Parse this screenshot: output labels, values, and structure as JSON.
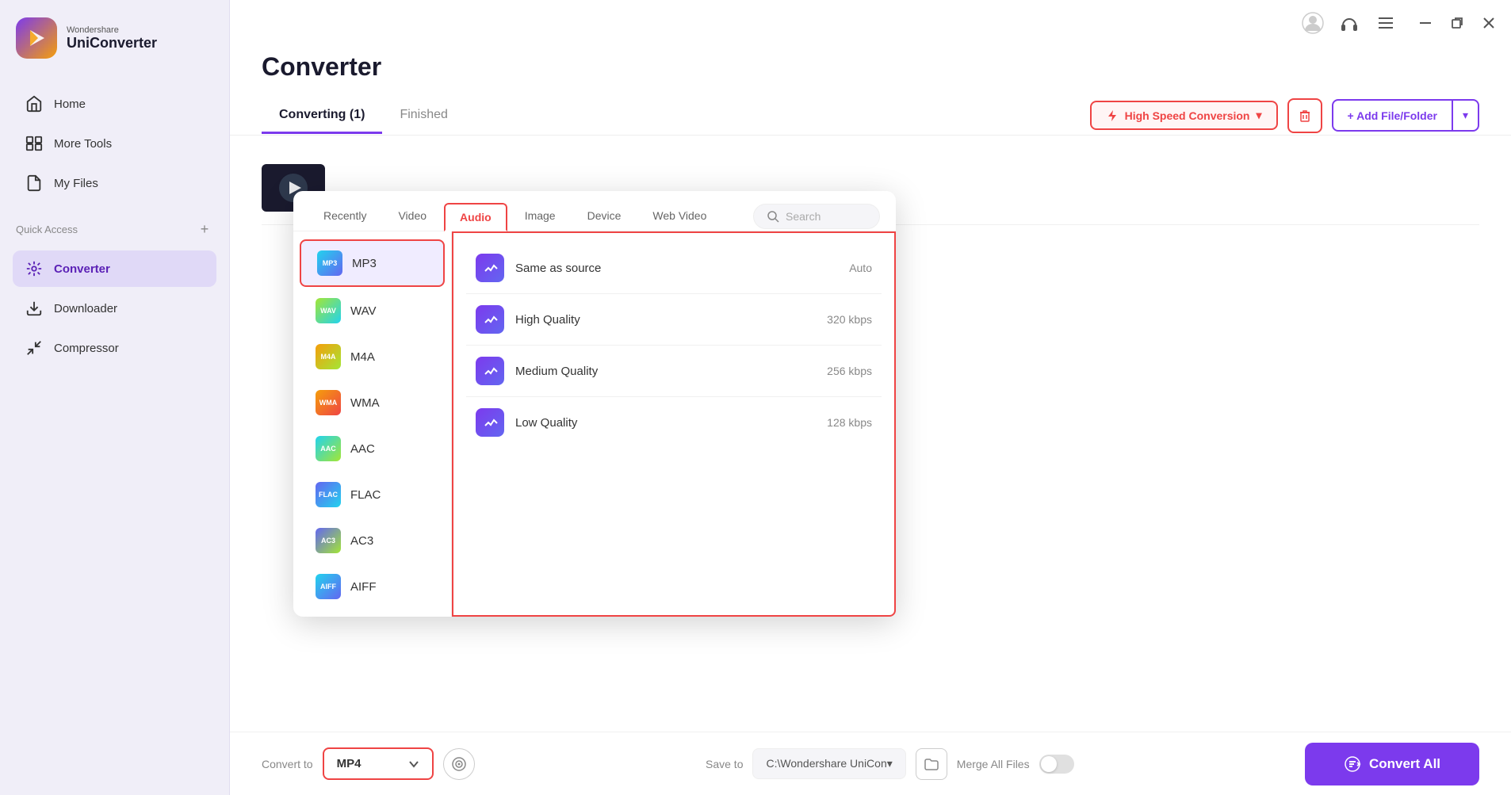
{
  "sidebar": {
    "brand": "Wondershare",
    "app_name": "UniConverter",
    "nav_items": [
      {
        "id": "home",
        "label": "Home",
        "active": false
      },
      {
        "id": "more-tools",
        "label": "More Tools",
        "active": false
      },
      {
        "id": "my-files",
        "label": "My Files",
        "active": false
      },
      {
        "id": "converter",
        "label": "Converter",
        "active": true
      },
      {
        "id": "downloader",
        "label": "Downloader",
        "active": false
      },
      {
        "id": "compressor",
        "label": "Compressor",
        "active": false
      }
    ],
    "quick_access_label": "Quick Access",
    "quick_access_plus": "+"
  },
  "titlebar": {
    "avatar_icon": "user-icon",
    "headset_icon": "headset-icon",
    "menu_icon": "menu-icon",
    "minimize_icon": "minimize-icon",
    "restore_icon": "restore-icon",
    "close_icon": "close-icon"
  },
  "page": {
    "title": "Converter",
    "tabs": [
      {
        "id": "converting",
        "label": "Converting (1)",
        "active": true
      },
      {
        "id": "finished",
        "label": "Finished",
        "active": false
      }
    ]
  },
  "toolbar": {
    "high_speed_label": "High Speed Conversion",
    "delete_label": "",
    "add_file_label": "+ Add File/Folder",
    "add_file_arrow": "▾"
  },
  "format_dropdown": {
    "tabs": [
      {
        "id": "recently",
        "label": "Recently",
        "active": false
      },
      {
        "id": "video",
        "label": "Video",
        "active": false
      },
      {
        "id": "audio",
        "label": "Audio",
        "active": true
      },
      {
        "id": "image",
        "label": "Image",
        "active": false
      },
      {
        "id": "device",
        "label": "Device",
        "active": false
      },
      {
        "id": "web-video",
        "label": "Web Video",
        "active": false
      }
    ],
    "search_placeholder": "Search",
    "formats": [
      {
        "id": "mp3",
        "label": "MP3",
        "icon_class": "mp3",
        "selected": true
      },
      {
        "id": "wav",
        "label": "WAV",
        "icon_class": "wav",
        "selected": false
      },
      {
        "id": "m4a",
        "label": "M4A",
        "icon_class": "m4a",
        "selected": false
      },
      {
        "id": "wma",
        "label": "WMA",
        "icon_class": "wma",
        "selected": false
      },
      {
        "id": "aac",
        "label": "AAC",
        "icon_class": "aac",
        "selected": false
      },
      {
        "id": "flac",
        "label": "FLAC",
        "icon_class": "flac",
        "selected": false
      },
      {
        "id": "ac3",
        "label": "AC3",
        "icon_class": "ac3",
        "selected": false
      },
      {
        "id": "aiff",
        "label": "AIFF",
        "icon_class": "aiff",
        "selected": false
      }
    ],
    "qualities": [
      {
        "id": "same-as-source",
        "label": "Same as source",
        "value": "Auto"
      },
      {
        "id": "high-quality",
        "label": "High Quality",
        "value": "320 kbps"
      },
      {
        "id": "medium-quality",
        "label": "Medium Quality",
        "value": "256 kbps"
      },
      {
        "id": "low-quality",
        "label": "Low Quality",
        "value": "128 kbps"
      }
    ]
  },
  "bottom_bar": {
    "convert_to_label": "Convert to",
    "convert_to_value": "MP4",
    "save_to_label": "Save to",
    "save_path": "C:\\Wondershare UniCon▾",
    "merge_label": "Merge All Files",
    "convert_all_label": "Convert All"
  }
}
